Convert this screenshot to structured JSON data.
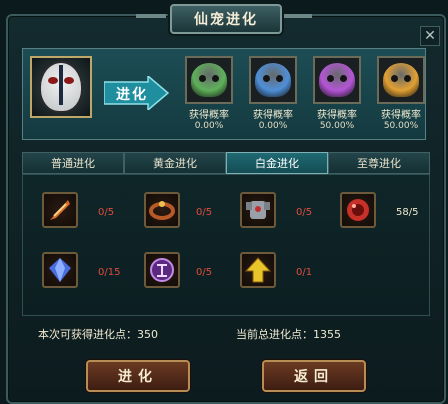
{
  "title": "仙宠进化",
  "close_glyph": "✕",
  "evolve_label": "进化",
  "results": [
    {
      "label": "获得概率",
      "pct": "0.00%",
      "color": "#5fb05a"
    },
    {
      "label": "获得概率",
      "pct": "0.00%",
      "color": "#4f8fd8"
    },
    {
      "label": "获得概率",
      "pct": "50.00%",
      "color": "#b455d6"
    },
    {
      "label": "获得概率",
      "pct": "50.00%",
      "color": "#e2a033"
    }
  ],
  "tabs": [
    "普通进化",
    "黄金进化",
    "白金进化",
    "至尊进化"
  ],
  "active_tab": 2,
  "items": [
    {
      "count": "0/5",
      "status": "bad",
      "icon": "feather-icon",
      "color": "#d46a24"
    },
    {
      "count": "0/5",
      "status": "bad",
      "icon": "ring-icon",
      "color": "#b85a28"
    },
    {
      "count": "0/5",
      "status": "bad",
      "icon": "armor-icon",
      "color": "#9aa0a8"
    },
    {
      "count": "58/5",
      "status": "ok",
      "icon": "orb-icon",
      "color": "#c8302a"
    },
    {
      "count": "0/15",
      "status": "bad",
      "icon": "crystal-icon",
      "color": "#4a6ee0"
    },
    {
      "count": "0/5",
      "status": "bad",
      "icon": "rune-icon",
      "color": "#9a4cc8"
    },
    {
      "count": "0/1",
      "status": "bad",
      "icon": "arrow-up-icon",
      "color": "#e8c62a"
    }
  ],
  "points_gain": "本次可获得进化点：350",
  "points_total": "当前总进化点：1355",
  "buttons": {
    "evolve": "进化",
    "back": "返回"
  }
}
